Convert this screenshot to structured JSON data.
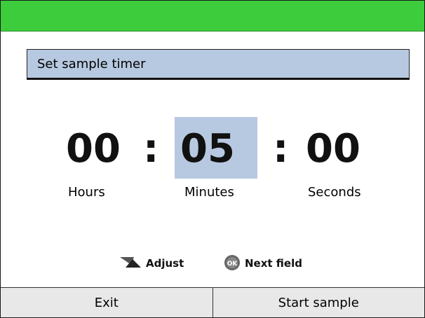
{
  "header": {
    "title": "Set sample timer"
  },
  "timer": {
    "hours": "00",
    "minutes": "05",
    "seconds": "00",
    "separator": ":",
    "labels": {
      "hours": "Hours",
      "minutes": "Minutes",
      "seconds": "Seconds"
    },
    "selected_field": "minutes"
  },
  "hints": {
    "adjust_icon": "up-down-arrows-icon",
    "adjust_label": "Adjust",
    "ok_icon": "ok-button-icon",
    "ok_icon_text": "OK",
    "next_label": "Next field"
  },
  "softkeys": {
    "left": "Exit",
    "right": "Start sample"
  },
  "colors": {
    "status_bar": "#3ccc3c",
    "highlight": "#b7c9e0"
  }
}
